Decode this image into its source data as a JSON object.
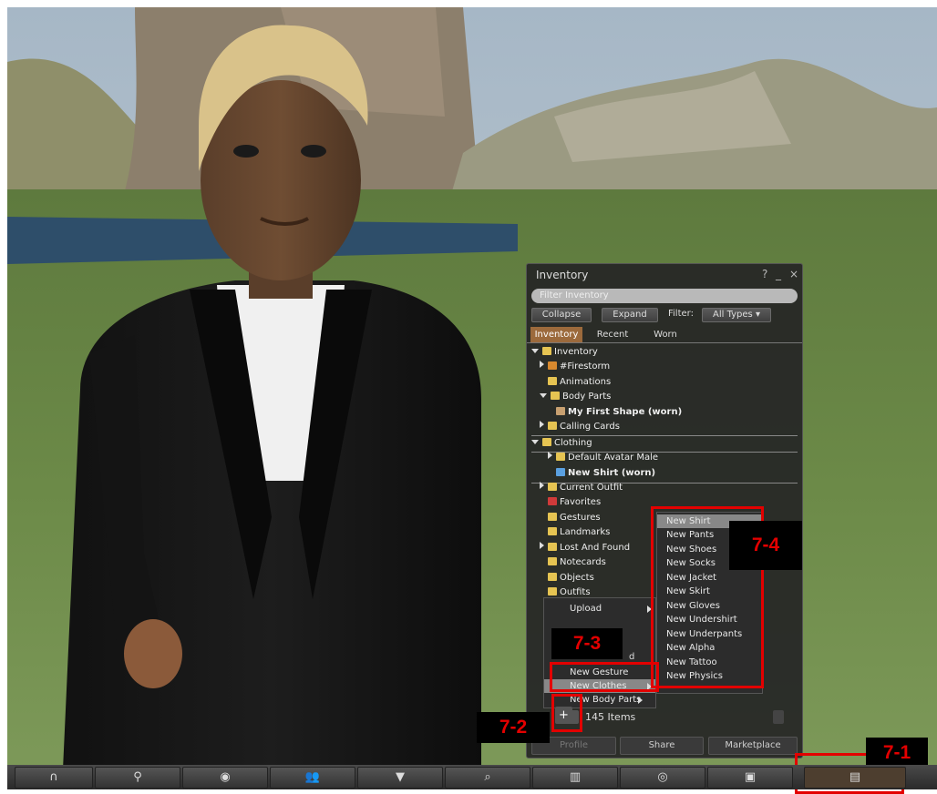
{
  "inventory": {
    "title": "Inventory",
    "controls": [
      "?",
      "_",
      "×"
    ],
    "filter_placeholder": "Filter Inventory",
    "collapse_label": "Collapse",
    "expand_label": "Expand",
    "filter_label": "Filter:",
    "filter_value": "All Types",
    "tabs": [
      "Inventory",
      "Recent",
      "Worn"
    ],
    "tree": [
      "Inventory",
      "#Firestorm",
      "Animations",
      "Body Parts",
      "My First Shape (worn)",
      "Calling Cards",
      "Clothing",
      "Default Avatar Male",
      "New Shirt (worn)",
      "Current Outfit",
      "Favorites",
      "Gestures",
      "Landmarks",
      "Lost And Found",
      "Notecards",
      "Objects",
      "Outfits"
    ],
    "item_count": "145 Items",
    "footer_buttons": [
      "Profile",
      "Share",
      "Marketplace"
    ]
  },
  "add_menu": {
    "items": [
      "Upload",
      "New Gesture",
      "New Clothes",
      "New Body Parts"
    ],
    "partial_text": "d"
  },
  "clothes_submenu": {
    "items": [
      "New Shirt",
      "New Pants",
      "New Shoes",
      "New Socks",
      "New Jacket",
      "New Skirt",
      "New Gloves",
      "New Undershirt",
      "New Underpants",
      "New Alpha",
      "New Tattoo",
      "New Physics"
    ]
  },
  "annotations": [
    "7-1",
    "7-2",
    "7-3",
    "7-4"
  ],
  "toolbar_icons": [
    "headphones-icon",
    "walk-icon",
    "eye-icon",
    "people-icon",
    "shirt-icon",
    "search-icon",
    "map-icon",
    "radar-icon",
    "camera-icon",
    "inventory-icon"
  ],
  "colors": {
    "annotation_red": "#e30000",
    "tab_active": "#9c6a3c"
  }
}
